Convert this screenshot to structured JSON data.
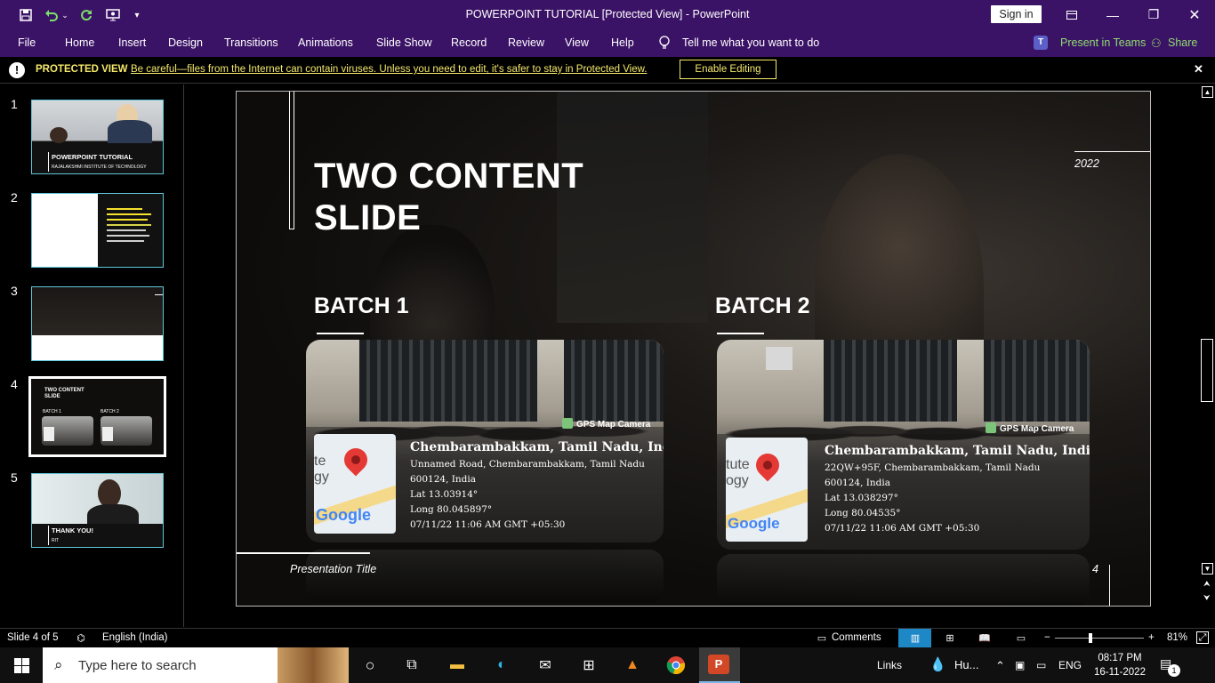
{
  "titlebar": {
    "title": "POWERPOINT TUTORIAL [Protected View]  -  PowerPoint",
    "sign_in": "Sign in",
    "qa_icons": [
      "save-icon",
      "undo-icon",
      "redo-icon",
      "slideshow-from-start-icon",
      "customize-qat-icon"
    ]
  },
  "menu": {
    "items": [
      "File",
      "Home",
      "Insert",
      "Design",
      "Transitions",
      "Animations",
      "Slide Show",
      "Record",
      "Review",
      "View",
      "Help"
    ],
    "tell_me": "Tell me what you want to do",
    "present_in_teams": "Present in Teams",
    "share": "Share"
  },
  "protected_view": {
    "title": "PROTECTED VIEW",
    "message": "Be careful—files from the Internet can contain viruses. Unless you need to edit, it's safer to stay in Protected View.",
    "enable_button": "Enable Editing"
  },
  "thumbnails": [
    {
      "number": "1",
      "title": "POWERPOINT TUTORIAL",
      "subtitle": "RAJALAKSHMI INSTITUTE OF TECHNOLOGY"
    },
    {
      "number": "2"
    },
    {
      "number": "3"
    },
    {
      "number": "4",
      "title": "TWO CONTENT SLIDE",
      "batch1": "BATCH 1",
      "batch2": "BATCH 2"
    },
    {
      "number": "5",
      "title": "THANK YOU!",
      "subtitle": "RIT"
    }
  ],
  "slide": {
    "title": "TWO CONTENT\nSLIDE",
    "year": "2022",
    "batch1": "BATCH 1",
    "batch2": "BATCH 2",
    "presentation_title": "Presentation Title",
    "slide_number": "4",
    "photo1": {
      "badge": "GPS Map Camera",
      "place": "Chembarambakkam, Tamil Nadu, India",
      "address": "Unnamed Road, Chembarambakkam, Tamil Nadu",
      "pin": "600124, India",
      "lat": "Lat 13.03914°",
      "long": "Long 80.045897°",
      "time": "07/11/22 11:06 AM GMT +05:30"
    },
    "photo2": {
      "badge": "GPS Map Camera",
      "place": "Chembarambakkam, Tamil Nadu, India",
      "address": "22QW+95F, Chembarambakkam, Tamil Nadu",
      "pin": "600124, India",
      "lat": "Lat 13.038297°",
      "long": "Long 80.04535°",
      "time": "07/11/22 11:06 AM GMT +05:30"
    }
  },
  "status": {
    "slide_of": "Slide 4 of 5",
    "language": "English (India)",
    "comments": "Comments",
    "zoom": "81%"
  },
  "taskbar": {
    "search_placeholder": "Type here to search",
    "links": "Links",
    "weather": "Hu...",
    "lang": "ENG",
    "time": "08:17 PM",
    "date": "16-11-2022",
    "notifications": "1"
  }
}
